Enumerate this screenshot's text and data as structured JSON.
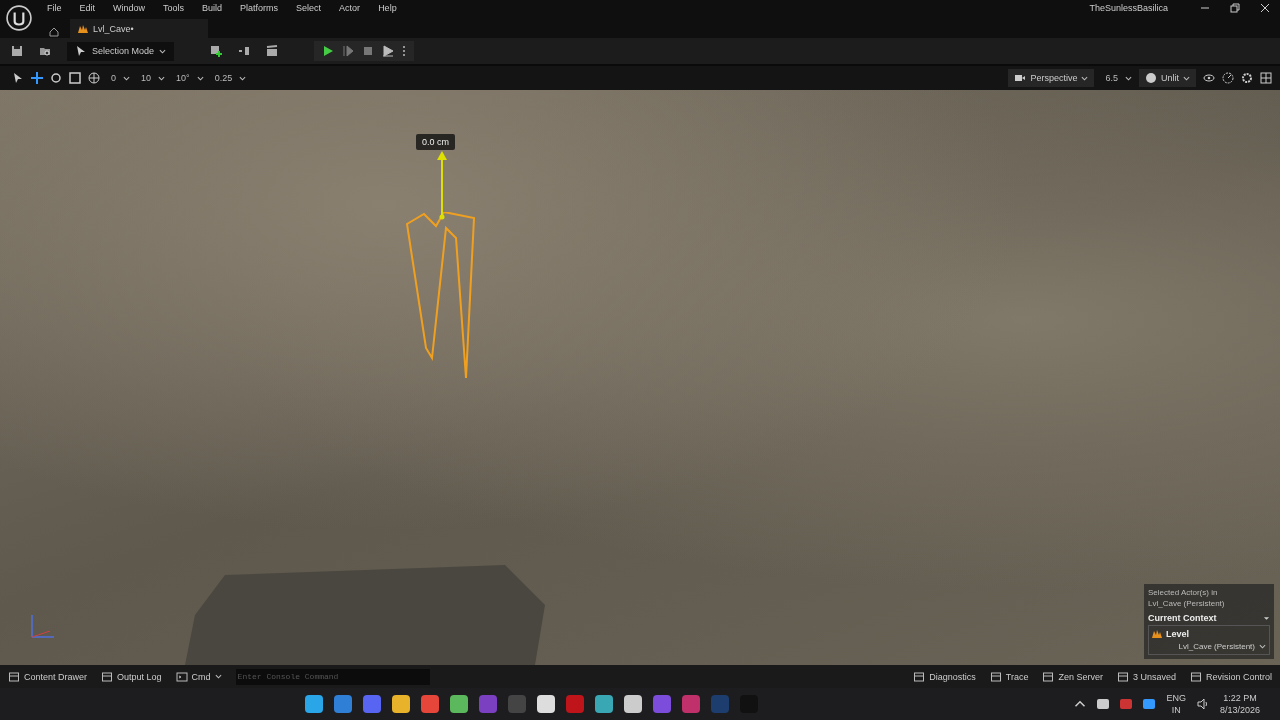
{
  "menu": [
    "File",
    "Edit",
    "Window",
    "Tools",
    "Build",
    "Platforms",
    "Select",
    "Actor",
    "Help"
  ],
  "project_title": "TheSunlessBasilica",
  "document_tab": {
    "label": "Lvl_Cave•"
  },
  "toolbar": {
    "mode": "Selection Mode"
  },
  "viewport_toolbar": {
    "snaps": [
      "0",
      "10",
      "10°",
      "0.25"
    ],
    "view_mode": "Perspective",
    "camera_speed": "6.5",
    "lighting": "Unlit"
  },
  "viewport": {
    "gizmo_readout": "0.0 cm",
    "context_panel": {
      "caption": "Selected Actor(s) in",
      "caption_level": "Lvl_Cave (Persistent)",
      "heading": "Current Context",
      "section": "Level",
      "level_value": "Lvl_Cave (Persistent)"
    }
  },
  "status_bar": {
    "left": [
      "Content Drawer",
      "Output Log"
    ],
    "cmd": "Cmd",
    "console_placeholder": "Enter Console Command",
    "right": [
      "Diagnostics",
      "Trace",
      "Zen Server",
      "3 Unsaved",
      "Revision Control"
    ]
  },
  "taskbar": {
    "language": "ENG",
    "region": "IN",
    "time": "1:22 PM",
    "date": "8/13/2026"
  }
}
